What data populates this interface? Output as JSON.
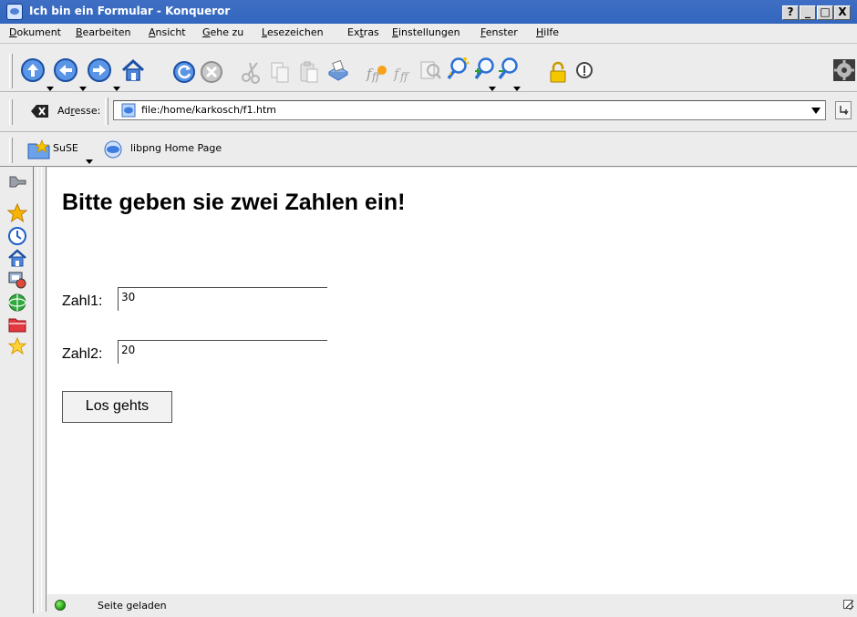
{
  "window": {
    "title": "Ich bin ein Formular - Konqueror",
    "buttons": [
      "?",
      "_",
      "□",
      "X"
    ]
  },
  "menu": [
    {
      "label": "Dokument",
      "accel": "D"
    },
    {
      "label": "Bearbeiten",
      "accel": "B"
    },
    {
      "label": "Ansicht",
      "accel": "A"
    },
    {
      "label": "Gehe zu",
      "accel": "G"
    },
    {
      "label": "Lesezeichen",
      "accel": "L"
    },
    {
      "label": "Extras",
      "accel": "t"
    },
    {
      "label": "Einstellungen",
      "accel": "E"
    },
    {
      "label": "Fenster",
      "accel": "F"
    },
    {
      "label": "Hilfe",
      "accel": "H"
    }
  ],
  "toolbar": {
    "icons": [
      "up-icon",
      "back-icon",
      "forward-icon",
      "home-icon",
      "reload-icon",
      "stop-icon",
      "cut-icon",
      "copy-icon",
      "paste-icon",
      "print-icon",
      "increase-font-icon",
      "decrease-font-icon",
      "find-icon",
      "zoom-icon",
      "zoom-in-icon",
      "zoom-out-icon",
      "security-lock-icon",
      "info-icon",
      "throbber-icon"
    ]
  },
  "location": {
    "label_pre": "Ad",
    "label_accel": "r",
    "label_post": "esse:",
    "url": "file:/home/karkosch/f1.htm"
  },
  "bookmarks": [
    {
      "label": "SuSE",
      "icon": "bookmark-folder-icon"
    },
    {
      "label": "libpng Home Page",
      "icon": "globe-icon"
    }
  ],
  "sidebar": {
    "icons": [
      "tools-icon",
      "bookmarks-star-icon",
      "history-icon",
      "home-icon",
      "services-icon",
      "network-icon",
      "folder-icon",
      "favorites-star-icon"
    ]
  },
  "page": {
    "title": "Bitte geben sie zwei Zahlen ein!",
    "field1_label": "Zahl1:",
    "field1_value": "30",
    "field2_label": "Zahl2:",
    "field2_value": "20",
    "submit_label": "Los gehts"
  },
  "status": {
    "text": "Seite geladen",
    "indicator_color": "#2db51a"
  },
  "colors": {
    "titlebar": "#3266be",
    "accent_blue": "#2a6fd6"
  }
}
